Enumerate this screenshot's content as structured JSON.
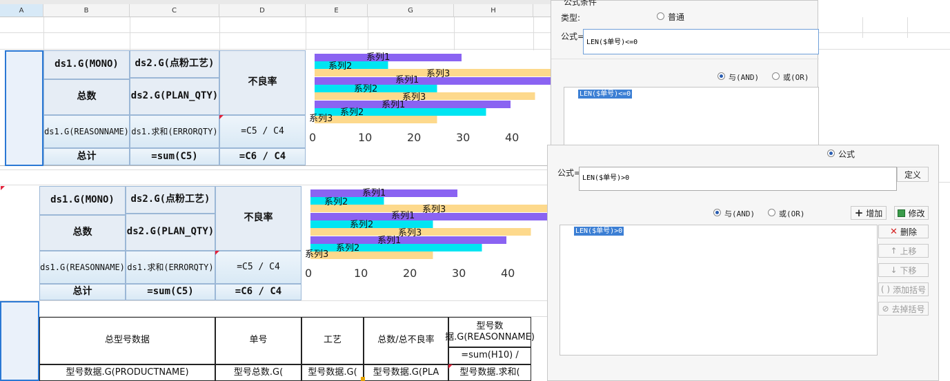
{
  "columns": [
    "A",
    "B",
    "C",
    "D",
    "E",
    "G",
    "H"
  ],
  "table_top": {
    "r1": {
      "b": "ds1.G(MONO)",
      "c": "ds2.G(点粉工艺)",
      "d": "不良率"
    },
    "r2": {
      "b": "总数",
      "c": "ds2.G(PLAN_QTY)"
    },
    "r3": {
      "b": "ds1.G(REASONNAME)",
      "c": "ds1.求和(ERRORQTY)",
      "d": "=C5 / C4"
    },
    "r4": {
      "b": "总计",
      "c": "=sum(C5)",
      "d": "=C6 / C4"
    }
  },
  "table_mid": {
    "r1": {
      "b": "ds1.G(MONO)",
      "c": "ds2.G(点粉工艺)",
      "d": "不良率"
    },
    "r2": {
      "b": "总数",
      "c": "ds2.G(PLAN_QTY)"
    },
    "r3": {
      "b": "ds1.G(REASONNAME)",
      "c": "ds1.求和(ERRORQTY)",
      "d": "=C5 / C4"
    },
    "r4": {
      "b": "总计",
      "c": "=sum(C5)",
      "d": "=C6 / C4"
    }
  },
  "table_bottom": {
    "header": [
      "总型号数据",
      "单号",
      "工艺",
      "总数/总不良率",
      "型号数据.G(REASONNAME)"
    ],
    "h_sub": "=sum(H10) /",
    "row": [
      "型号数据.G(PRODUCTNAME)",
      "型号总数.G(",
      "型号数据.G(",
      "型号数据.G(PLA",
      "型号数据.求和("
    ]
  },
  "chart_data": [
    {
      "type": "bar",
      "orientation": "horizontal",
      "xlim": [
        0,
        45
      ],
      "xticks": [
        "0",
        "10",
        "20",
        "30",
        "40"
      ],
      "series": [
        {
          "name": "系列1",
          "color": "#8a63f2",
          "values": [
            30,
            50,
            40
          ]
        },
        {
          "name": "系列2",
          "color": "#00e5f2",
          "values": [
            15,
            25,
            35
          ]
        },
        {
          "name": "系列3",
          "color": "#fdd98c",
          "values": [
            50,
            45,
            25
          ]
        }
      ]
    },
    {
      "type": "bar",
      "orientation": "horizontal",
      "xlim": [
        0,
        45
      ],
      "xticks": [
        "0",
        "10",
        "20",
        "30",
        "40"
      ],
      "series": [
        {
          "name": "系列1",
          "color": "#8a63f2",
          "values": [
            30,
            50,
            40
          ]
        },
        {
          "name": "系列2",
          "color": "#00e5f2",
          "values": [
            15,
            25,
            35
          ]
        },
        {
          "name": "系列3",
          "color": "#fdd98c",
          "values": [
            50,
            45,
            25
          ]
        }
      ]
    }
  ],
  "dialog1": {
    "title": "公式条件",
    "type_label": "类型:",
    "radio_normal": "普通",
    "formula_label": "公式=",
    "formula_value": "LEN($单号)<=0",
    "and_label": "与(AND)",
    "or_label": "或(OR)",
    "list_item": "LEN($单号)<=0"
  },
  "dialog2": {
    "radio_formula": "公式",
    "formula_label": "公式=",
    "formula_value": "LEN($单号)>0",
    "define_button": "定义",
    "and_label": "与(AND)",
    "or_label": "或(OR)",
    "add_button": "增加",
    "modify_button": "修改",
    "delete_button": "删除",
    "up_button": "上移",
    "down_button": "下移",
    "add_bracket_button": "添加括号",
    "remove_bracket_button": "去掉括号",
    "list_item": "LEN($单号)>0"
  },
  "colors": {
    "series1": "#8a63f2",
    "series2": "#00e5f2",
    "series3": "#fdd98c",
    "selection": "#2a78d4",
    "highlight": "#3c7fd4"
  }
}
